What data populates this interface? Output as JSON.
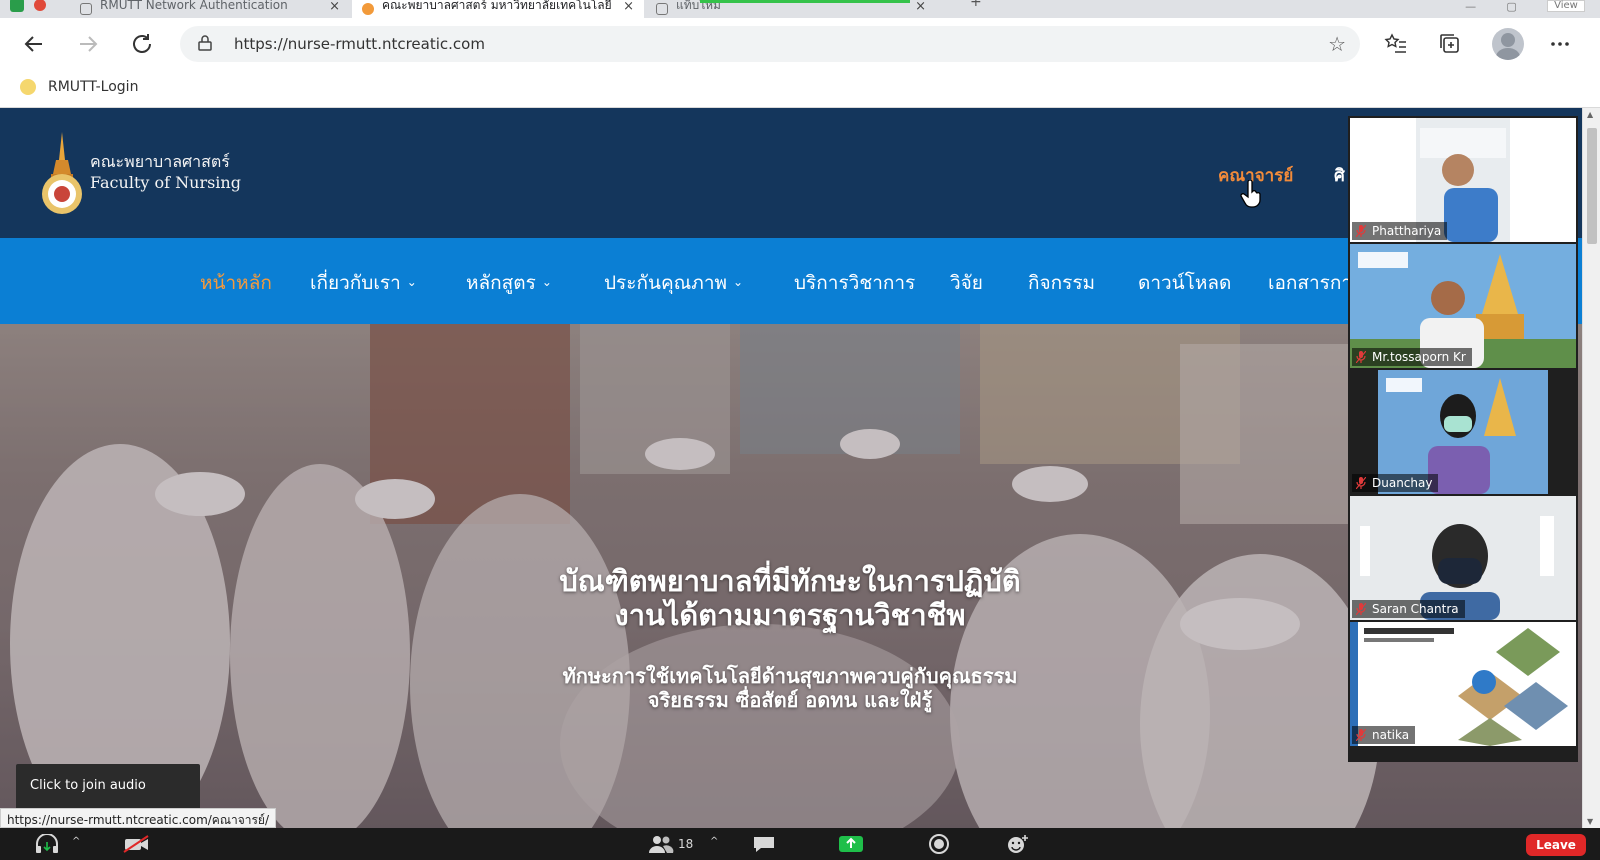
{
  "browser": {
    "tabs": [
      {
        "title": "RMUTT Network Authentication",
        "close": "×"
      },
      {
        "title": "คณะพยาบาลศาสตร์ มหาวิทยาลัยเทคโนโลยี",
        "close": "×"
      },
      {
        "title": "แท็บใหม่",
        "close": "×"
      }
    ],
    "new_tab": "+",
    "view_label": "View",
    "url": "https://nurse-rmutt.ntcreatic.com",
    "bookmark": "RMUTT-Login"
  },
  "site": {
    "logo_line1": "คณะพยาบาลศาสตร์",
    "logo_line2": "Faculty of Nursing",
    "header_links": [
      "คณาจารย์",
      "ศิ"
    ],
    "nav": [
      {
        "label": "หน้าหลัก",
        "dropdown": false
      },
      {
        "label": "เกี่ยวกับเรา",
        "dropdown": true
      },
      {
        "label": "หลักสูตร",
        "dropdown": true
      },
      {
        "label": "ประกันคุณภาพ",
        "dropdown": true
      },
      {
        "label": "บริการวิชาการ",
        "dropdown": false
      },
      {
        "label": "วิจัย",
        "dropdown": false
      },
      {
        "label": "กิจกรรม",
        "dropdown": false
      },
      {
        "label": "ดาวน์โหลด",
        "dropdown": false
      },
      {
        "label": "เอกสารกา",
        "dropdown": false
      }
    ],
    "hero_title_1": "บัณฑิตพยาบาลที่มีทักษะในการปฏิบัติ",
    "hero_title_2": "งานได้ตามมาตรฐานวิชาชีพ",
    "hero_sub_1": "ทักษะการใช้เทคโนโลยีด้านสุขภาพควบคู่กับคุณธรรม",
    "hero_sub_2": "จริยธรรม ซื่อสัตย์ อดทน และใฝ่รู้"
  },
  "status_url": "https://nurse-rmutt.ntcreatic.com/คณาจารย์/",
  "zoom": {
    "tooltip": "Click to join audio",
    "participants_count": "18",
    "leave_label": "Leave",
    "participants": [
      {
        "name": "Phatthariya"
      },
      {
        "name": "Mr.tossaporn Kr"
      },
      {
        "name": "Duanchay"
      },
      {
        "name": "Saran Chantra"
      },
      {
        "name": "natika"
      }
    ],
    "icons": [
      "headphones-icon",
      "video-off-icon",
      "participants-icon",
      "chat-icon",
      "share-screen-icon",
      "record-icon",
      "reactions-icon"
    ]
  },
  "colors": {
    "header_bg": "#14365c",
    "nav_bg": "#0b7fd4",
    "accent_orange": "#f28b3a",
    "leave_red": "#e02828",
    "share_green": "#1fbf4a"
  }
}
